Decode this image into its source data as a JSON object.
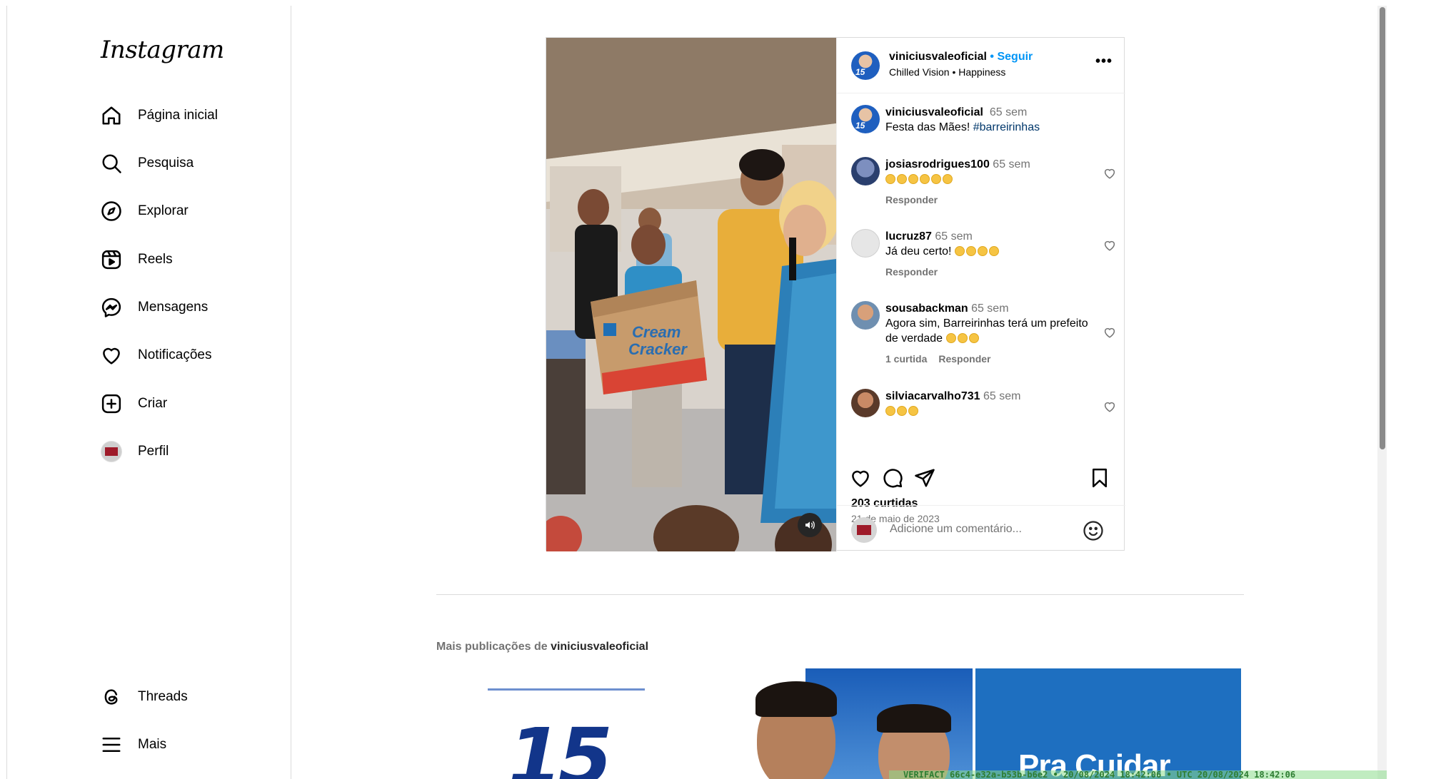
{
  "app": {
    "logo_text": "Instagram"
  },
  "sidebar": {
    "items": [
      {
        "label": "Página inicial",
        "icon": "home-icon"
      },
      {
        "label": "Pesquisa",
        "icon": "search-icon"
      },
      {
        "label": "Explorar",
        "icon": "compass-icon"
      },
      {
        "label": "Reels",
        "icon": "reels-icon"
      },
      {
        "label": "Mensagens",
        "icon": "messenger-icon"
      },
      {
        "label": "Notificações",
        "icon": "heart-icon"
      },
      {
        "label": "Criar",
        "icon": "plus-square-icon"
      },
      {
        "label": "Perfil",
        "icon": "profile-avatar"
      }
    ],
    "bottom_items": [
      {
        "label": "Threads",
        "icon": "threads-icon"
      },
      {
        "label": "Mais",
        "icon": "menu-icon"
      }
    ]
  },
  "post": {
    "author": "viniciusvaleoficial",
    "dot": "•",
    "follow_label": "Seguir",
    "audio": "Chilled Vision • Happiness",
    "caption": {
      "user": "viniciusvaleoficial",
      "time": "65 sem",
      "text": "Festa das Mães! ",
      "hashtag": "#barreirinhas"
    },
    "comments": [
      {
        "user": "josiasrodrigues100",
        "time": "65 sem",
        "text": "",
        "emoji_count": 6,
        "likes": "",
        "reply": "Responder"
      },
      {
        "user": "lucruz87",
        "time": "65 sem",
        "text": "Já deu certo! ",
        "emoji_count": 4,
        "likes": "",
        "reply": "Responder"
      },
      {
        "user": "sousabackman",
        "time": "65 sem",
        "text": "Agora sim, Barreirinhas terá um prefeito de verdade ",
        "emoji_count": 3,
        "likes": "1 curtida",
        "reply": "Responder"
      },
      {
        "user": "silviacarvalho731",
        "time": "65 sem",
        "text": "",
        "emoji_count": 3,
        "likes": "",
        "reply": ""
      }
    ],
    "likes_count": "203 curtidas",
    "date": "21 de maio de 2023",
    "comment_placeholder": "Adicione um comentário...",
    "more_symbol": "•••"
  },
  "more_posts": {
    "prefix": "Mais publicações de ",
    "user": "viniciusvaleoficial",
    "thumb1_text": "15",
    "thumb3_text": "Pra Cuidar"
  },
  "watermark": "VERIFACT 66c4-e32a-b53b-b6e2 • 20/08/2024 18:42:06 • UTC 20/08/2024 18:42:06",
  "colors": {
    "accent": "#0095f6",
    "border": "#dbdbdb",
    "muted": "#737373",
    "hashtag": "#00376b"
  }
}
